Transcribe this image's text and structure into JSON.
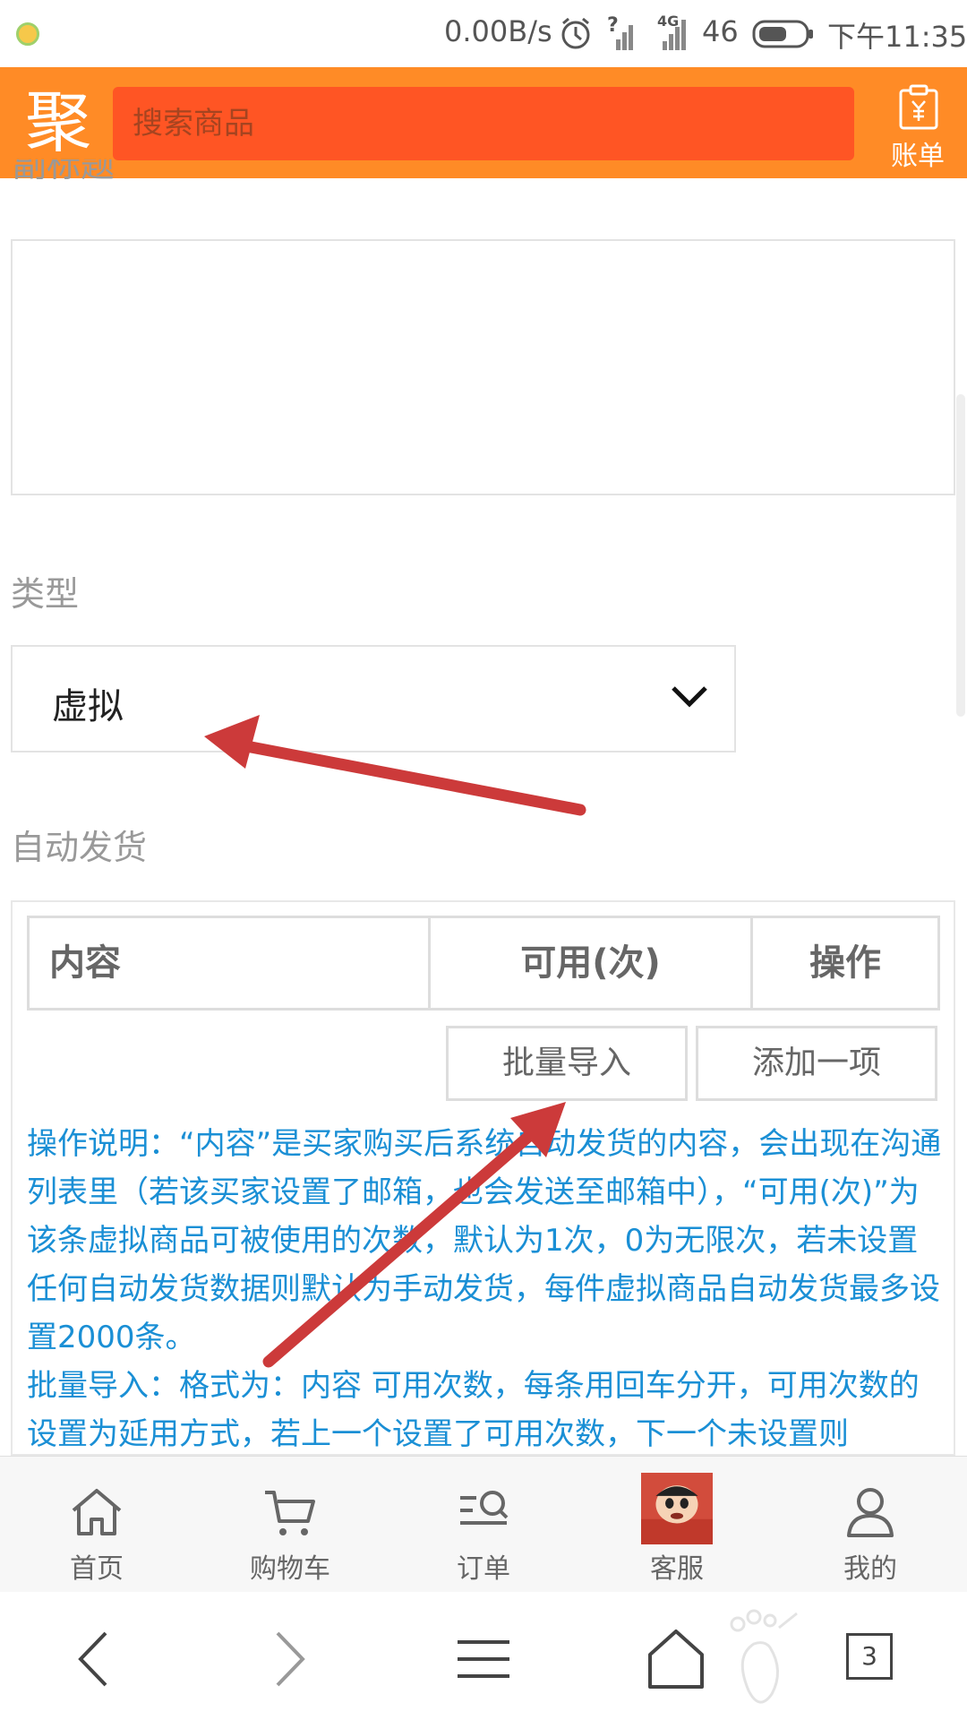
{
  "status_bar": {
    "network_speed": "0.00B/s",
    "signal_help": "?",
    "network_type": "4G",
    "signal_label": "46",
    "time": "下午11:35"
  },
  "header": {
    "logo_char": "聚",
    "search_placeholder": "搜索商品",
    "bill_label": "账单"
  },
  "form": {
    "subtitle_label": "副标题",
    "subtitle_value": "",
    "type_label": "类型",
    "type_selected": "虚拟",
    "auto_delivery_label": "自动发货",
    "table_headers": [
      "内容",
      "可用(次)",
      "操作"
    ],
    "batch_import_button": "批量导入",
    "add_item_button": "添加一项",
    "instructions": [
      "操作说明：“内容”是买家购买后系统自动发货的内容，会出现在沟通列表里（若该买家设置了邮箱，也会发送至邮箱中），“可用(次)”为该条虚拟商品可被使用的次数，默认为1次，0为无限次，若未设置任何自动发货数据则默认为手动发货，每件虚拟商品自动发货最多设置2000条。",
      "批量导入：格式为：内容 可用次数，每条用回车分开，可用次数的设置为延用方式，若上一个设置了可用次数，下一个未设置则"
    ]
  },
  "tabbar": {
    "items": [
      {
        "label": "首页",
        "icon": "home-icon"
      },
      {
        "label": "购物车",
        "icon": "cart-icon"
      },
      {
        "label": "订单",
        "icon": "order-search-icon"
      },
      {
        "label": "客服",
        "icon": "service-avatar"
      },
      {
        "label": "我的",
        "icon": "user-icon"
      }
    ]
  },
  "browser_nav": {
    "tab_count": "3"
  },
  "colors": {
    "header_bg": "#ff8b26",
    "search_bg": "#ff5524",
    "instruction_text": "#1a8fd5",
    "annotation_arrow": "#cc3a3a"
  }
}
